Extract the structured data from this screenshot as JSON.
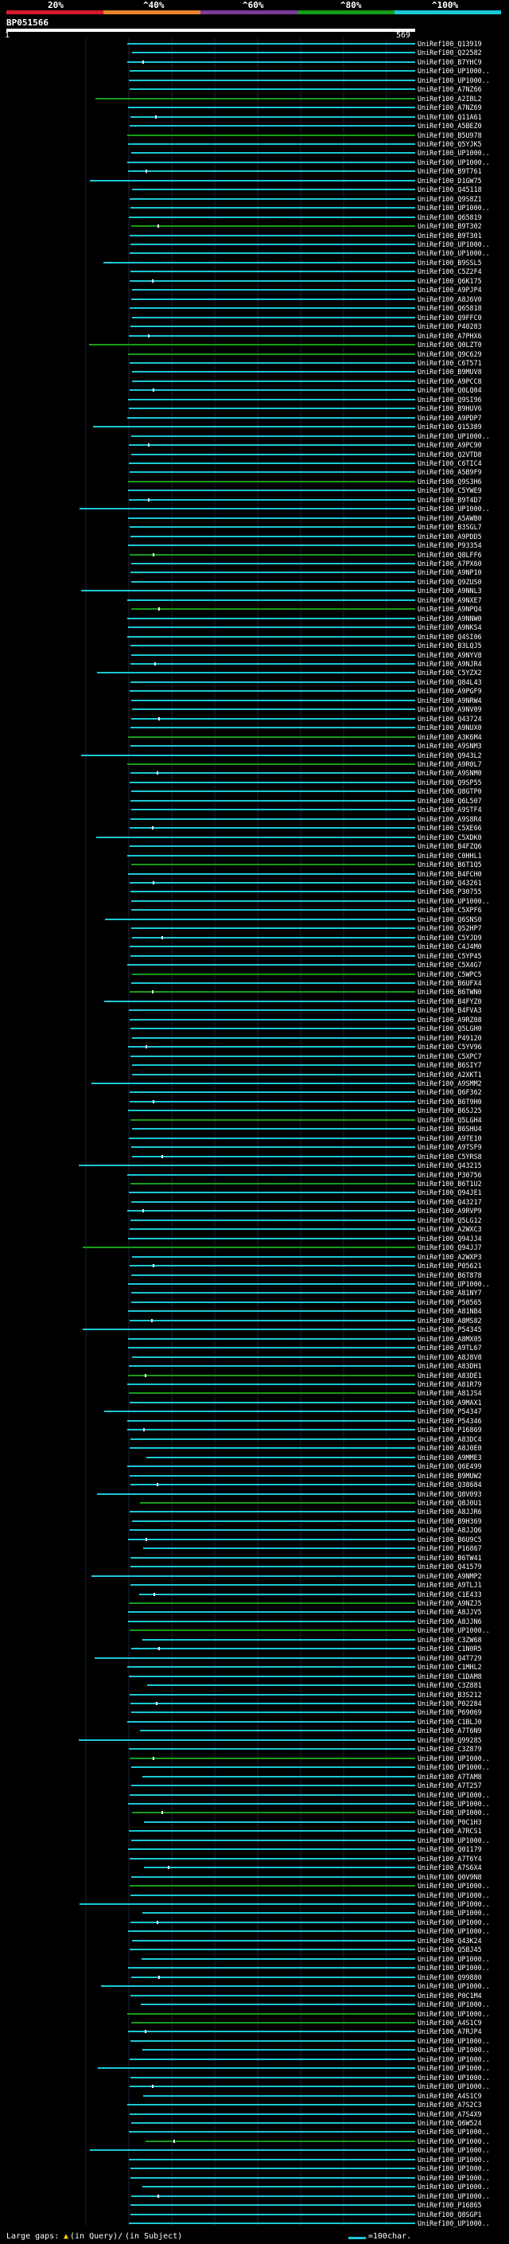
{
  "query": {
    "name": "BP051566",
    "start": "1",
    "end": "569"
  },
  "color_scale": [
    {
      "label": "20%",
      "color": "#d7192b"
    },
    {
      "label": "^40%",
      "color": "#e8842b"
    },
    {
      "label": "^60%",
      "color": "#7a3a9a"
    },
    {
      "label": "^80%",
      "color": "#179b1b"
    },
    {
      "label": "^100%",
      "color": "#1ac8d6"
    }
  ],
  "legend": {
    "large_gaps": "Large gaps:",
    "in_query": "(in Query)/",
    "in_subject": "(in Subject)",
    "scale_note": "=100char."
  },
  "chart_data": {
    "type": "alignment-overview",
    "x_range": [
      1,
      569
    ],
    "hits": [
      "UniRef100_Q13919",
      "UniRef100_Q22582",
      "UniRef100_B7YHC9",
      "UniRef100_UP1000..",
      "UniRef100_UP1000..",
      "UniRef100_A7NZ66",
      "UniRef100_A2IBL2",
      "UniRef100_A7NZ69",
      "UniRef100_Q11A61",
      "UniRef100_A5BEZ0",
      "UniRef100_B5U978",
      "UniRef100_Q5YJK5",
      "UniRef100_UP1000..",
      "UniRef100_UP1000..",
      "UniRef100_B9T761",
      "UniRef100_D1GW75",
      "UniRef100_Q45118",
      "UniRef100_Q9S8Z1",
      "UniRef100_UP1000..",
      "UniRef100_Q65819",
      "UniRef100_B9T302",
      "UniRef100_B9T301",
      "UniRef100_UP1000..",
      "UniRef100_UP1000..",
      "UniRef100_B9SSL5",
      "UniRef100_C5Z2F4",
      "UniRef100_Q6K175",
      "UniRef100_A9PJP4",
      "UniRef100_A8J6V0",
      "UniRef100_Q65818",
      "UniRef100_Q9FFC0",
      "UniRef100_P40283",
      "UniRef100_A7PHX6",
      "UniRef100_Q0LZT0",
      "UniRef100_Q9C629",
      "UniRef100_C6T571",
      "UniRef100_B9MUV8",
      "UniRef100_A9PCC8",
      "UniRef100_Q0LQ04",
      "UniRef100_Q9SI96",
      "UniRef100_B9HUV6",
      "UniRef100_A9PDP7",
      "UniRef100_Q15389",
      "UniRef100_UP1000..",
      "UniRef100_A9PC90",
      "UniRef100_Q2VTD8",
      "UniRef100_C6TIC4",
      "UniRef100_A5B9F9",
      "UniRef100_Q9S3H6",
      "UniRef100_C5YWE9",
      "UniRef100_B9T4D7",
      "UniRef100_UP1000..",
      "UniRef100_A5AWB0",
      "UniRef100_B3SGL7",
      "UniRef100_A9PDD5",
      "UniRef100_P93354",
      "UniRef100_Q8LFF6",
      "UniRef100_A7PX60",
      "UniRef100_A9NP10",
      "UniRef100_Q9ZUS0",
      "UniRef100_A9NNL3",
      "UniRef100_A9NXE7",
      "UniRef100_A9NPQ4",
      "UniRef100_A9NNW0",
      "UniRef100_A9NKS4",
      "UniRef100_Q4SI06",
      "UniRef100_B3LQJ5",
      "UniRef100_A9NYV8",
      "UniRef100_A9NJR4",
      "UniRef100_C5YZX2",
      "UniRef100_Q84L43",
      "UniRef100_A9PGF9",
      "UniRef100_A9NRW4",
      "UniRef100_A9NV09",
      "UniRef100_Q43724",
      "UniRef100_A9NUX0",
      "UniRef100_A3K6M4",
      "UniRef100_A9SNM3",
      "UniRef100_Q943L2",
      "UniRef100_A9R0L7",
      "UniRef100_A9SNM0",
      "UniRef100_Q9SP55",
      "UniRef100_Q8GTP0",
      "UniRef100_Q6L507",
      "UniRef100_A9STF4",
      "UniRef100_A9S8R4",
      "UniRef100_C5XE66",
      "UniRef100_C5XDK0",
      "UniRef100_B4FZQ6",
      "UniRef100_C0HHL1",
      "UniRef100_B6T1Q5",
      "UniRef100_B4FCH0",
      "UniRef100_Q43261",
      "UniRef100_P30755",
      "UniRef100_UP1000..",
      "UniRef100_C5XPF6",
      "UniRef100_Q6SNS0",
      "UniRef100_Q52HP7",
      "UniRef100_C5YJD9",
      "UniRef100_C4J4M0",
      "UniRef100_C5YP45",
      "UniRef100_C5X4G7",
      "UniRef100_C5WPC5",
      "UniRef100_B6UFX4",
      "UniRef100_B6TWN0",
      "UniRef100_B4FYZ0",
      "UniRef100_B4FVA3",
      "UniRef100_A9RZ08",
      "UniRef100_Q5LGH0",
      "UniRef100_P49120",
      "UniRef100_C5YV96",
      "UniRef100_C5XPC7",
      "UniRef100_B6SIY7",
      "UniRef100_A2XKT1",
      "UniRef100_A9SMM2",
      "UniRef100_Q6F362",
      "UniRef100_B6T9H0",
      "UniRef100_B6SJ25",
      "UniRef100_Q5LGH4",
      "UniRef100_B6SHU4",
      "UniRef100_A9TE10",
      "UniRef100_A9TSF9",
      "UniRef100_C5YRS8",
      "UniRef100_Q43215",
      "UniRef100_P30756",
      "UniRef100_B6T1U2",
      "UniRef100_Q94JE1",
      "UniRef100_Q43217",
      "UniRef100_A9RVP9",
      "UniRef100_Q5LG12",
      "UniRef100_A2WXC3",
      "UniRef100_Q94JJ4",
      "UniRef100_Q94JJ7",
      "UniRef100_A2WXP3",
      "UniRef100_P05621",
      "UniRef100_B6T878",
      "UniRef100_UP1000..",
      "UniRef100_A81NY7",
      "UniRef100_P50565",
      "UniRef100_A81NB4",
      "UniRef100_A8MS82",
      "UniRef100_P54345",
      "UniRef100_A8MX05",
      "UniRef100_A9TL67",
      "UniRef100_A8J8V8",
      "UniRef100_A83DH1",
      "UniRef100_A83DE1",
      "UniRef100_A81R79",
      "UniRef100_A81JS4",
      "UniRef100_A9MAX1",
      "UniRef100_P54347",
      "UniRef100_P54346",
      "UniRef100_P16869",
      "UniRef100_A83DC4",
      "UniRef100_A8J0E0",
      "UniRef100_A9MME3",
      "UniRef100_Q6E499",
      "UniRef100_B9MUW2",
      "UniRef100_Q38684",
      "UniRef100_Q8V093",
      "UniRef100_Q8J0U1",
      "UniRef100_A8JJR6",
      "UniRef100_B9H369",
      "UniRef100_A8JJQ6",
      "UniRef100_B6U9C5",
      "UniRef100_P16867",
      "UniRef100_B6TW41",
      "UniRef100_Q41579",
      "UniRef100_A9NMP2",
      "UniRef100_A9TLJ1",
      "UniRef100_C1E433",
      "UniRef100_A9NZJ5",
      "UniRef100_A8JJV5",
      "UniRef100_A8JJN6",
      "UniRef100_UP1000..",
      "UniRef100_C3ZW68",
      "UniRef100_C1N0R5",
      "UniRef100_Q4T729",
      "UniRef100_C1MHL2",
      "UniRef100_C1DAM8",
      "UniRef100_C3Z881",
      "UniRef100_B3S212",
      "UniRef100_P02284",
      "UniRef100_P69069",
      "UniRef100_C1BLJ0",
      "UniRef100_A7T6N9",
      "UniRef100_Q99285",
      "UniRef100_C3Z879",
      "UniRef100_UP1000..",
      "UniRef100_UP1000..",
      "UniRef100_A7TAM8",
      "UniRef100_A7T257",
      "UniRef100_UP1000..",
      "UniRef100_UP1000..",
      "UniRef100_UP1000..",
      "UniRef100_P0C1H3",
      "UniRef100_A7RCS1",
      "UniRef100_UP1000..",
      "UniRef100_Q01179",
      "UniRef100_A7T6Y4",
      "UniRef100_A7S6X4",
      "UniRef100_Q0V9N8",
      "UniRef100_UP1000..",
      "UniRef100_UP1000..",
      "UniRef100_UP1000..",
      "UniRef100_UP1000..",
      "UniRef100_UP1000..",
      "UniRef100_UP1000..",
      "UniRef100_Q43K24",
      "UniRef100_Q5BJ45",
      "UniRef100_UP1000..",
      "UniRef100_UP1000..",
      "UniRef100_Q99880",
      "UniRef100_UP1000..",
      "UniRef100_P0C1M4",
      "UniRef100_UP1000..",
      "UniRef100_UP1000..",
      "UniRef100_A4S1C9",
      "UniRef100_A7RJP4",
      "UniRef100_UP1000..",
      "UniRef100_UP1000..",
      "UniRef100_UP1000..",
      "UniRef100_UP1000..",
      "UniRef100_UP1000..",
      "UniRef100_UP1000..",
      "UniRef100_A4S1C9",
      "UniRef100_A7S2C3",
      "UniRef100_A7S4X9",
      "UniRef100_Q6W524",
      "UniRef100_UP1000..",
      "UniRef100_UP1000..",
      "UniRef100_UP1000..",
      "UniRef100_UP1000..",
      "UniRef100_UP1000..",
      "UniRef100_UP1000..",
      "UniRef100_UP1000..",
      "UniRef100_UP1000..",
      "UniRef100_P16865",
      "UniRef100_Q8SGP1",
      "UniRef100_UP1000.."
    ]
  }
}
